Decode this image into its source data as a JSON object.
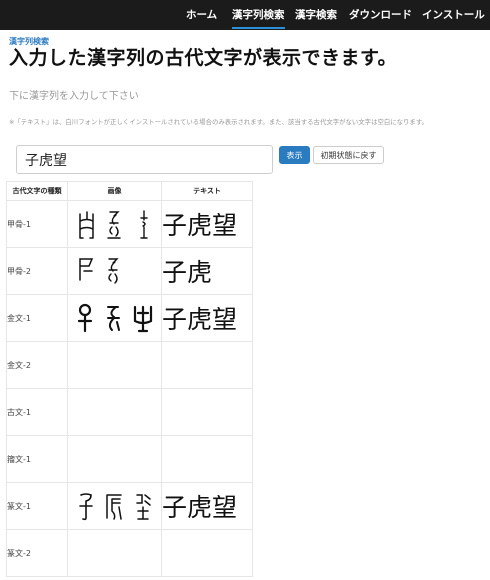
{
  "nav": {
    "items": [
      {
        "label": "ホーム",
        "active": false
      },
      {
        "label": "漢字列検索",
        "active": true
      },
      {
        "label": "漢字検索",
        "active": false
      },
      {
        "label": "ダウンロード",
        "active": false
      },
      {
        "label": "インストール",
        "active": false
      }
    ]
  },
  "header": {
    "breadcrumb": "漢字列検索",
    "title": "入力した漢字列の古代文字が表示できます。",
    "subtitle": "下に漢字列を入力して下さい",
    "note": "※「テキスト」は、白川フォントが正しくインストールされている場合のみ表示されます。また、該当する古代文字がない文字は空白になります。"
  },
  "search": {
    "value": "子虎望",
    "placeholder": "",
    "show_label": "表示",
    "reset_label": "初期状態に戻す"
  },
  "table": {
    "headers": [
      "古代文字の種類",
      "画像",
      "テキスト"
    ],
    "rows": [
      {
        "type": "甲骨-1",
        "images": [
          "ko-child-glyph",
          "ko-tiger-glyph",
          "ko-gaze-glyph"
        ],
        "text": "子虎望"
      },
      {
        "type": "甲骨-2",
        "images": [
          "ko-child-glyph",
          "ko-tiger-glyph"
        ],
        "text": "子虎"
      },
      {
        "type": "金文-1",
        "images": [
          "kinbun-child-glyph",
          "kinbun-tiger-glyph",
          "kinbun-gaze-glyph"
        ],
        "text": "子虎望"
      },
      {
        "type": "金文-2",
        "images": [],
        "text": ""
      },
      {
        "type": "古文-1",
        "images": [],
        "text": ""
      },
      {
        "type": "籀文-1",
        "images": [],
        "text": ""
      },
      {
        "type": "篆文-1",
        "images": [
          "tensho-child-glyph",
          "tensho-tiger-glyph",
          "tensho-gaze-glyph"
        ],
        "text": "子虎望"
      },
      {
        "type": "篆文-2",
        "images": [],
        "text": ""
      }
    ]
  }
}
